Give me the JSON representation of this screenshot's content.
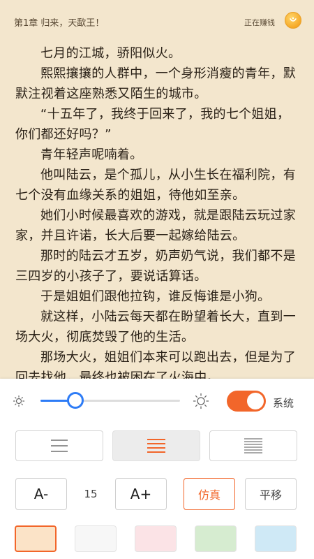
{
  "header": {
    "chapter_title": "第1章 归来，天歃王！",
    "earning_label": "正在赚钱",
    "coin_icon": "coin-icon"
  },
  "content": {
    "paragraphs": [
      "七月的江城，骄阳似火。",
      "熙熙攘攘的人群中，一个身形消瘦的青年，默默注视着这座熟悉又陌生的城市。",
      "“十五年了，我终于回来了，我的七个姐姐，你们都还好吗？”",
      "青年轻声呢喃着。",
      "他叫陆云，是个孤儿，从小生长在福利院，有七个没有血缘关系的姐姐，待他如至亲。",
      "她们小时候最喜欢的游戏，就是跟陆云玩过家家，并且许诺，长大后要一起嫁给陆云。",
      "那时的陆云才五岁，奶声奶气说，我们都不是三四岁的小孩子了，要说话算话。",
      "于是姐姐们跟他拉钩，谁反悔谁是小狗。",
      "就这样，小陆云每天都在盼望着长大，直到一场大火，彻底焚毁了他的生活。",
      "那场大火，姐姐们本来可以跑出去，但是为了回去找他，最终也被困在了火海中。"
    ]
  },
  "settings": {
    "brightness": {
      "value": 0.25,
      "accent": "#2e7cf6",
      "low_icon": "sun-small-icon",
      "high_icon": "sun-large-icon"
    },
    "system_toggle": {
      "on": true,
      "label": "系统",
      "color": "#f2662a"
    },
    "spacing": {
      "options": [
        "wide",
        "medium",
        "narrow"
      ],
      "selected": "medium"
    },
    "font": {
      "decrease_label": "A-",
      "size": "15",
      "increase_label": "A+"
    },
    "page_mode": {
      "simulate_label": "仿真",
      "slide_label": "平移",
      "selected": "simulate"
    },
    "themes": [
      {
        "color": "#fbe3c7",
        "selected": true
      },
      {
        "color": "#f7f7f7",
        "selected": false
      },
      {
        "color": "#fbe3e6",
        "selected": false
      },
      {
        "color": "#d6ecd0",
        "selected": false
      },
      {
        "color": "#cfe9f6",
        "selected": false
      }
    ]
  }
}
